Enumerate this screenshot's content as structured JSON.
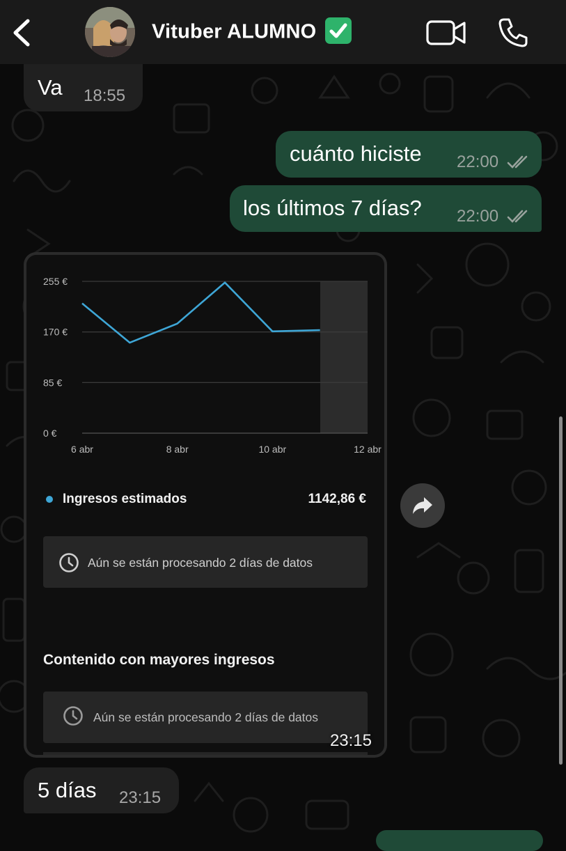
{
  "header": {
    "contact_name": "Vituber ALUMNO",
    "verified_icon": "check-mark-button-emoji",
    "back_icon": "chevron-left-icon",
    "video_icon": "video-camera-icon",
    "phone_icon": "phone-icon"
  },
  "messages": [
    {
      "direction": "incoming",
      "text": "Va",
      "time": "18:55"
    },
    {
      "direction": "outgoing",
      "text": "cuánto hiciste",
      "time": "22:00",
      "status": "read"
    },
    {
      "direction": "outgoing",
      "text": "los últimos 7 días?",
      "time": "22:00",
      "status": "read"
    },
    {
      "direction": "incoming",
      "type": "image",
      "time": "23:15"
    },
    {
      "direction": "incoming",
      "text": "5 días",
      "time": "23:15"
    }
  ],
  "screenshot": {
    "legend_label": "Ingresos estimados",
    "legend_value": "1142,86 €",
    "notice_1": "Aún se están procesando 2 días de datos",
    "section_title": "Contenido con mayores ingresos",
    "notice_2": "Aún se están procesando 2 días de datos"
  },
  "chart_data": {
    "type": "line",
    "title": "",
    "xlabel": "",
    "ylabel": "",
    "y_ticks": [
      "0 €",
      "85 €",
      "170 €",
      "255 €"
    ],
    "ylim": [
      0,
      255
    ],
    "x_ticks": [
      "6 abr",
      "8 abr",
      "10 abr",
      "12 abr"
    ],
    "categories": [
      "6 abr",
      "7 abr",
      "8 abr",
      "9 abr",
      "10 abr",
      "11 abr"
    ],
    "series": [
      {
        "name": "Ingresos estimados",
        "values": [
          218,
          152,
          184,
          253,
          171,
          173
        ]
      }
    ],
    "shaded_region": "11 abr – 12 abr (processing)",
    "grid": true,
    "line_color": "#3ea6d6"
  },
  "colors": {
    "background": "#0b0b0b",
    "incoming_bubble": "#202020",
    "outgoing_bubble": "#1f4a37",
    "chart_line": "#3ea6d6"
  }
}
